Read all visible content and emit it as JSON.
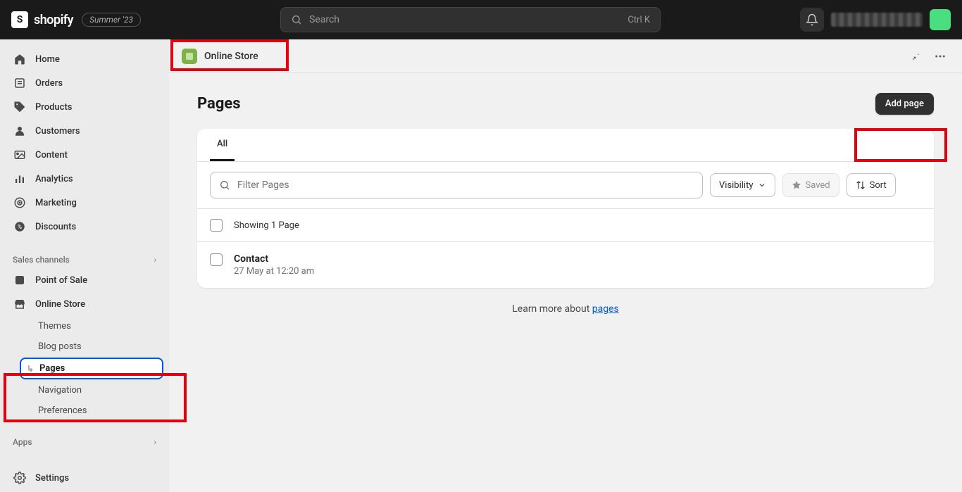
{
  "topbar": {
    "logo_text": "shopify",
    "badge": "Summer '23",
    "search_placeholder": "Search",
    "search_shortcut": "Ctrl K"
  },
  "sidebar": {
    "items": [
      {
        "label": "Home"
      },
      {
        "label": "Orders"
      },
      {
        "label": "Products"
      },
      {
        "label": "Customers"
      },
      {
        "label": "Content"
      },
      {
        "label": "Analytics"
      },
      {
        "label": "Marketing"
      },
      {
        "label": "Discounts"
      }
    ],
    "section_channels": "Sales channels",
    "channels": [
      {
        "label": "Point of Sale"
      },
      {
        "label": "Online Store"
      }
    ],
    "online_store_sub": [
      {
        "label": "Themes"
      },
      {
        "label": "Blog posts"
      },
      {
        "label": "Pages"
      },
      {
        "label": "Navigation"
      },
      {
        "label": "Preferences"
      }
    ],
    "section_apps": "Apps",
    "settings": "Settings"
  },
  "channel_bar": {
    "name": "Online Store"
  },
  "page": {
    "title": "Pages",
    "add_button": "Add page",
    "tabs": {
      "all": "All"
    },
    "filter_placeholder": "Filter Pages",
    "visibility_label": "Visibility",
    "saved_label": "Saved",
    "sort_label": "Sort",
    "showing_text": "Showing 1 Page",
    "rows": [
      {
        "title": "Contact",
        "sub": "27 May at 12:20 am"
      }
    ],
    "learn_prefix": "Learn more about ",
    "learn_link": "pages"
  }
}
